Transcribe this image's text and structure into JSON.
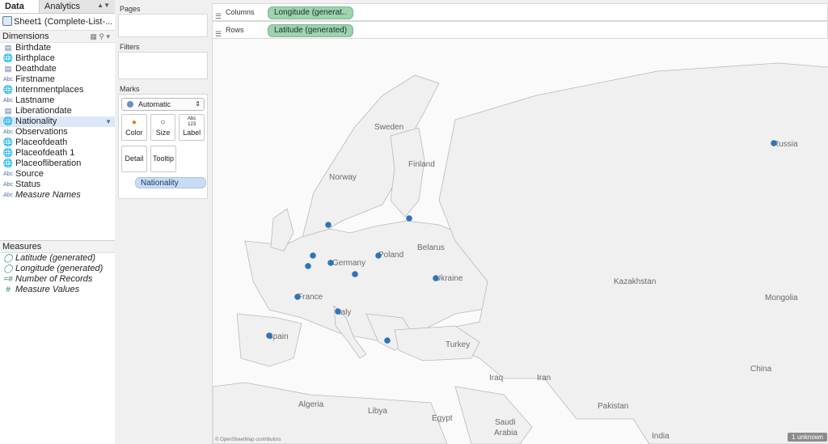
{
  "tabs": {
    "data": "Data",
    "analytics": "Analytics"
  },
  "source": "Sheet1 (Complete-List-...",
  "dimensions": {
    "header": "Dimensions",
    "fields": [
      {
        "label": "Birthdate",
        "type": "date"
      },
      {
        "label": "Birthplace",
        "type": "geo"
      },
      {
        "label": "Deathdate",
        "type": "date"
      },
      {
        "label": "Firstname",
        "type": "string"
      },
      {
        "label": "Internmentplaces",
        "type": "geo"
      },
      {
        "label": "Lastname",
        "type": "string"
      },
      {
        "label": "Liberationdate",
        "type": "date"
      },
      {
        "label": "Nationality",
        "type": "geo",
        "selected": true
      },
      {
        "label": "Observations",
        "type": "string"
      },
      {
        "label": "Placeofdeath",
        "type": "geo"
      },
      {
        "label": "Placeofdeath 1",
        "type": "geo"
      },
      {
        "label": "Placeofliberation",
        "type": "geo"
      },
      {
        "label": "Source",
        "type": "string"
      },
      {
        "label": "Status",
        "type": "string"
      },
      {
        "label": "Measure Names",
        "type": "string",
        "italic": true
      }
    ]
  },
  "measures": {
    "header": "Measures",
    "fields": [
      {
        "label": "Latitude (generated)",
        "type": "geo-measure",
        "italic": true
      },
      {
        "label": "Longitude (generated)",
        "type": "geo-measure",
        "italic": true
      },
      {
        "label": "Number of Records",
        "type": "number-calc",
        "italic": true
      },
      {
        "label": "Measure Values",
        "type": "number",
        "italic": true
      }
    ]
  },
  "cards": {
    "pages": "Pages",
    "filters": "Filters",
    "marks": "Marks",
    "mark_type": "Automatic",
    "buttons": {
      "color": "Color",
      "size": "Size",
      "label": "Label",
      "detail": "Detail",
      "tooltip": "Tooltip"
    },
    "label_icon_text": "Abc\n123",
    "detail_pill": "Nationality"
  },
  "shelves": {
    "columns_label": "Columns",
    "columns_pill": "Longitude (generat..",
    "rows_label": "Rows",
    "rows_pill": "Latitude (generated)"
  },
  "map": {
    "labels": [
      "Sweden",
      "Norway",
      "Finland",
      "Belarus",
      "Poland",
      "Germany",
      "Ukraine",
      "France",
      "Italy",
      "Spain",
      "Turkey",
      "Iraq",
      "Iran",
      "Kazakhstan",
      "Mongolia",
      "Russia",
      "China",
      "Algeria",
      "Libya",
      "Egypt",
      "Saudi Arabia",
      "Pakistan",
      "India"
    ],
    "credit": "© OpenStreetMap contributors",
    "unknown_badge": "1 unknown",
    "mark_color": "#2f75b5"
  }
}
